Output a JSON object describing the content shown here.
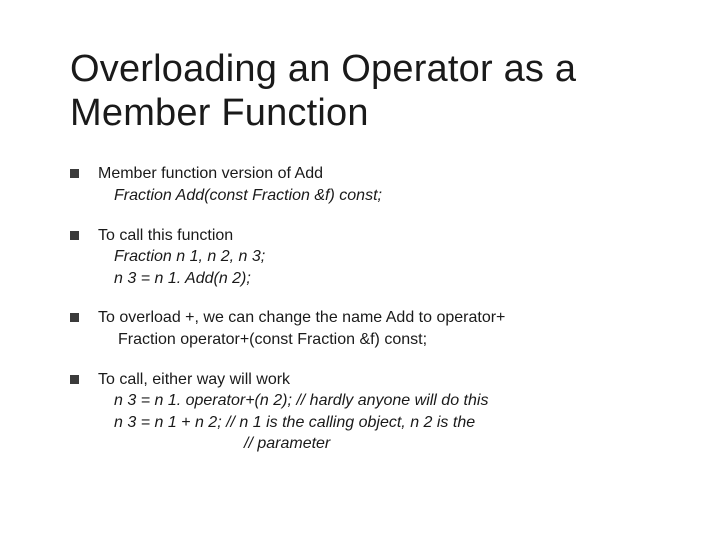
{
  "title": "Overloading an Operator as a Member Function",
  "bullets": [
    {
      "lead": "Member function version of Add",
      "subs": [
        {
          "text": "Fraction Add(const Fraction &f) const;",
          "class": "sub ital"
        }
      ]
    },
    {
      "lead": "To call this function",
      "subs": [
        {
          "text": "Fraction n 1, n 2, n 3;",
          "class": "sub ital"
        },
        {
          "text": "n 3 = n 1. Add(n 2);",
          "class": "sub ital"
        }
      ]
    },
    {
      "lead": "To overload +, we can change the name Add to operator+",
      "subs": [
        {
          "text": "Fraction operator+(const Fraction &f) const;",
          "class": "sub-wide"
        }
      ]
    },
    {
      "lead": "To call, either way will work",
      "subs": [
        {
          "text": "n 3 = n 1. operator+(n 2);  // hardly anyone will do this",
          "class": "sub ital"
        },
        {
          "text": "n 3 = n 1 + n 2;  // n 1 is the calling object, n 2 is the",
          "class": "sub ital"
        },
        {
          "text": "//  parameter",
          "class": "indent-cont ital"
        }
      ]
    }
  ]
}
